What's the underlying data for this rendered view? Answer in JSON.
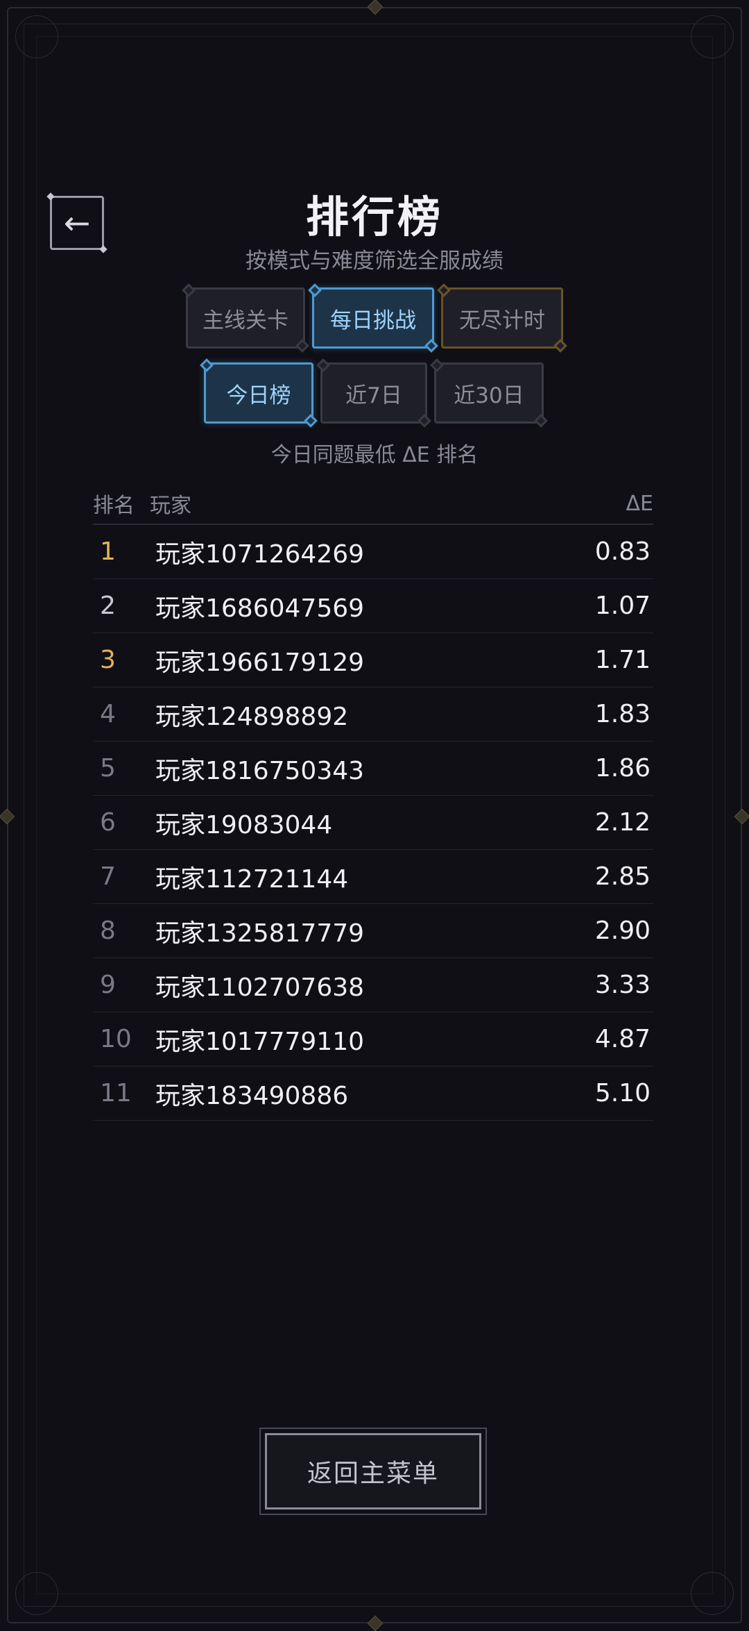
{
  "header": {
    "back_icon": "←",
    "title": "排行榜",
    "subtitle": "按模式与难度筛选全服成绩"
  },
  "mode_tabs": [
    {
      "label": "主线关卡",
      "active": false
    },
    {
      "label": "每日挑战",
      "active": true
    },
    {
      "label": "无尽计时",
      "active": false
    }
  ],
  "period_tabs": [
    {
      "label": "今日榜",
      "active": true
    },
    {
      "label": "近7日",
      "active": false
    },
    {
      "label": "近30日",
      "active": false
    }
  ],
  "note": "今日同题最低 ΔE 排名",
  "table": {
    "col_rank": "排名",
    "col_player": "玩家",
    "col_de": "ΔE",
    "rows": [
      {
        "rank": "1",
        "player": "玩家1071264269",
        "de": "0.83"
      },
      {
        "rank": "2",
        "player": "玩家1686047569",
        "de": "1.07"
      },
      {
        "rank": "3",
        "player": "玩家1966179129",
        "de": "1.71"
      },
      {
        "rank": "4",
        "player": "玩家124898892",
        "de": "1.83"
      },
      {
        "rank": "5",
        "player": "玩家1816750343",
        "de": "1.86"
      },
      {
        "rank": "6",
        "player": "玩家19083044",
        "de": "2.12"
      },
      {
        "rank": "7",
        "player": "玩家112721144",
        "de": "2.85"
      },
      {
        "rank": "8",
        "player": "玩家1325817779",
        "de": "2.90"
      },
      {
        "rank": "9",
        "player": "玩家1102707638",
        "de": "3.33"
      },
      {
        "rank": "10",
        "player": "玩家1017779110",
        "de": "4.87"
      },
      {
        "rank": "11",
        "player": "玩家183490886",
        "de": "5.10"
      }
    ]
  },
  "footer": {
    "menu_label": "返回主菜单"
  },
  "colors": {
    "accent_blue": "#4e9bd0",
    "gold": "#e2b458",
    "background": "#0f0f15"
  }
}
